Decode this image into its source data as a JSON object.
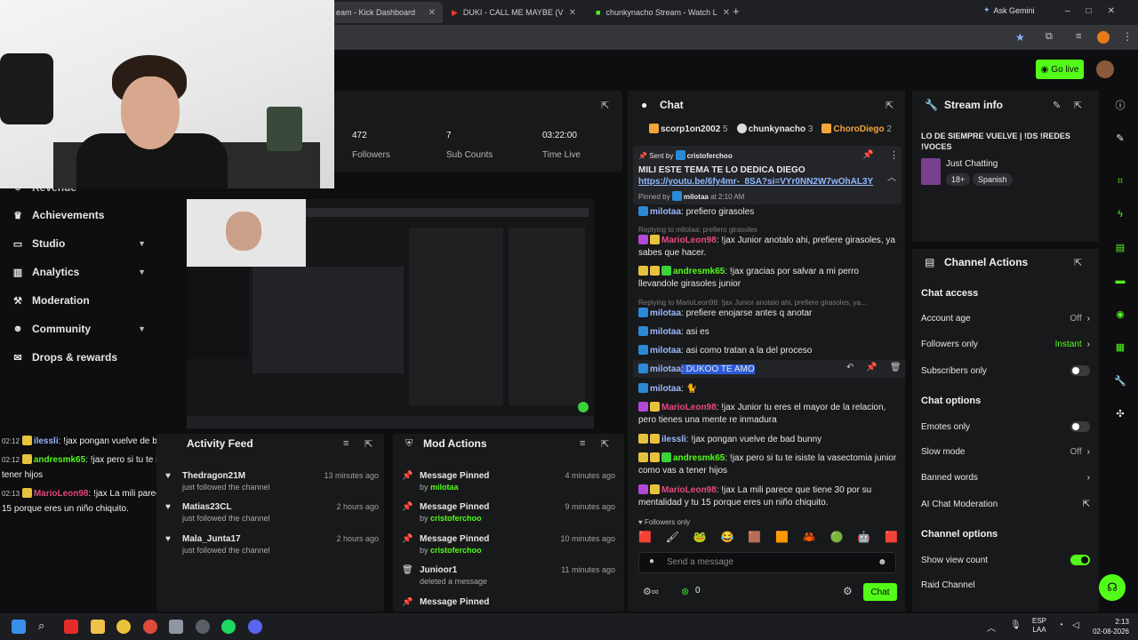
{
  "browser": {
    "tabs": [
      {
        "title": "eam - Kick Dashboard",
        "active": true
      },
      {
        "title": "DUKI - CALL ME MAYBE (V",
        "active": false
      },
      {
        "title": "chunkynacho Stream - Watch L",
        "active": false
      }
    ],
    "ask_gemini": "Ask Gemini"
  },
  "header": {
    "go_live": "Go live"
  },
  "sidebar": {
    "partial_item": "Revenue",
    "items": [
      {
        "label": "Achievements",
        "icon": "trophy-icon",
        "expandable": false
      },
      {
        "label": "Studio",
        "icon": "monitor-icon",
        "expandable": true
      },
      {
        "label": "Analytics",
        "icon": "chart-icon",
        "expandable": true
      },
      {
        "label": "Moderation",
        "icon": "hammer-icon",
        "expandable": false
      },
      {
        "label": "Community",
        "icon": "people-icon",
        "expandable": true
      },
      {
        "label": "Drops & rewards",
        "icon": "gift-icon",
        "expandable": false
      }
    ]
  },
  "stats": [
    {
      "value": "472",
      "label": "Followers"
    },
    {
      "value": "7",
      "label": "Sub Counts"
    },
    {
      "value": "03:22:00",
      "label": "Time Live"
    }
  ],
  "overlay_chat": [
    {
      "time": "02:12",
      "user": "ilessli",
      "text": ": !jax pongan vuelve de bad bunny"
    },
    {
      "time": "02:12",
      "user": "andresmk65",
      "text": ": !jax pero si tu te isiste la vasectomía junior como vas a tener hijos"
    },
    {
      "time": "02:13",
      "user": "MarioLeon98",
      "text": ": !jax La mili parece que tiene 30 por su mentalidad y tu 15 porque eres un niño chiquito."
    }
  ],
  "activity_feed": {
    "title": "Activity Feed",
    "items": [
      {
        "name": "Thedragon21M",
        "action": "just followed the channel",
        "when": "13 minutes ago"
      },
      {
        "name": "Matias23CL",
        "action": "just followed the channel",
        "when": "2 hours ago"
      },
      {
        "name": "Mala_Junta17",
        "action": "just followed the channel",
        "when": "2 hours ago"
      }
    ]
  },
  "mod_actions": {
    "title": "Mod Actions",
    "items": [
      {
        "action": "Message Pinned",
        "by": "by",
        "user": "milotaa",
        "when": "4 minutes ago",
        "icon": "pin-icon"
      },
      {
        "action": "Message Pinned",
        "by": "by",
        "user": "cristoferchoo",
        "when": "9 minutes ago",
        "icon": "pin-icon"
      },
      {
        "action": "Message Pinned",
        "by": "by",
        "user": "cristoferchoo",
        "when": "10 minutes ago",
        "icon": "pin-icon"
      },
      {
        "action": "Junioor1",
        "by": "",
        "user": "deleted a message",
        "when": "11 minutes ago",
        "icon": "trash-icon"
      },
      {
        "action": "Message Pinned",
        "by": "",
        "user": "",
        "when": "11 minutes ago",
        "icon": "pin-icon"
      }
    ]
  },
  "chat": {
    "title": "Chat",
    "top_gifters": [
      {
        "name": "scorp1on2002",
        "count": "5"
      },
      {
        "name": "chunkynacho",
        "count": "3"
      },
      {
        "name": "ChoroDiego",
        "count": "2"
      }
    ],
    "pinned": {
      "sent_by_label": "Sent by",
      "sent_by": "cristoferchoo",
      "text": "MILI ESTE TEMA TE LO DEDICA DIEGO",
      "link": "https://youtu.be/6fy4mr-_8SA?si=VYr0NN2W7wOhAL3Y",
      "pinned_by_label": "Pinned by",
      "pinned_by": "milotaa",
      "pinned_at": "at 2:10 AM"
    },
    "messages": [
      {
        "reply": "",
        "user": "milotaa",
        "color": "blu",
        "text": ": prefiero girasoles"
      },
      {
        "reply": "Replying to milotaa: prefiero girasoles",
        "user": "MarioLeon98",
        "color": "mag",
        "text": ": !jax Junior anotalo ahi, prefiere girasoles, ya sabes que hacer."
      },
      {
        "reply": "",
        "user": "andresmk65",
        "color": "grn",
        "text": ": !jax gracias por salvar a mi perro llevandole girasoles junior"
      },
      {
        "reply": "Replying to MarioLeon98: !jax Junior anotalo ahi, prefiere girasoles, ya...",
        "user": "milotaa",
        "color": "blu",
        "text": ": prefiere enojarse antes q anotar"
      },
      {
        "reply": "",
        "user": "milotaa",
        "color": "blu",
        "text": ": asi es"
      },
      {
        "reply": "",
        "user": "milotaa",
        "color": "blu",
        "text": ": asi como tratan a la del proceso"
      },
      {
        "reply": "",
        "user": "milotaa",
        "color": "blu",
        "text": ": DUKOO TE AMO"
      },
      {
        "reply": "",
        "user": "milotaa",
        "color": "blu",
        "text": ":"
      },
      {
        "reply": "",
        "user": "MarioLeon98",
        "color": "mag",
        "text": ": !jax Junior tu eres el mayor de la relacion, pero tienes una mente re inmadura"
      },
      {
        "reply": "",
        "user": "ilessli",
        "color": "blu",
        "text": ": !jax pongan vuelve de bad bunny"
      },
      {
        "reply": "",
        "user": "andresmk65",
        "color": "grn",
        "text": ": !jax pero si tu te isiste la vasectomia junior como vas a tener hijos"
      },
      {
        "reply": "",
        "user": "MarioLeon98",
        "color": "mag",
        "text": ": !jax La mili parece que tiene 30 por su mentalidad y tu 15 porque eres un niño chiquito."
      }
    ],
    "followers_only": "Followers only",
    "placeholder": "Send a message",
    "count": "0",
    "chat_button": "Chat"
  },
  "stream_info": {
    "title": "Stream info",
    "stream_title": "LO DE SIEMPRE VUELVE | !DS !REDES !VOCES",
    "category": "Just Chatting",
    "tags": [
      "18+",
      "Spanish"
    ]
  },
  "channel_actions": {
    "title": "Channel Actions",
    "chat_access": "Chat access",
    "account_age": {
      "label": "Account age",
      "value": "Off"
    },
    "followers_only": {
      "label": "Followers only",
      "value": "Instant"
    },
    "subscribers_only": {
      "label": "Subscribers only",
      "on": false
    },
    "chat_options": "Chat options",
    "emotes_only": {
      "label": "Emotes only",
      "on": false
    },
    "slow_mode": {
      "label": "Slow mode",
      "value": "Off"
    },
    "banned_words": "Banned words",
    "ai_mod": "AI Chat Moderation",
    "channel_options": "Channel options",
    "show_view_count": {
      "label": "Show view count",
      "on": true
    },
    "raid": "Raid Channel"
  },
  "taskbar": {
    "lang": "ESP",
    "lang2": "LAA",
    "time": "2:13",
    "date": "02-08-2026"
  },
  "colors": {
    "accent": "#53fc18",
    "panel": "#18191b"
  }
}
